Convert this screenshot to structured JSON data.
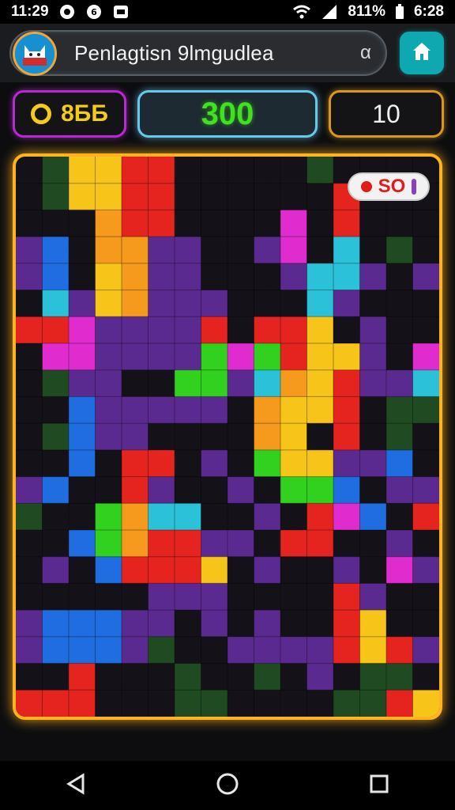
{
  "status_bar": {
    "time": "11:29",
    "battery_text": "811%",
    "clock_right": "6:28",
    "icons": [
      "settings-icon",
      "notification-icon",
      "message-icon",
      "wifi-icon",
      "signal-icon",
      "battery-icon"
    ]
  },
  "header": {
    "title": "Penlagtisn 9lmgudlea",
    "title_icon": "α",
    "logo": "app-logo",
    "home_icon": "home-icon"
  },
  "stats": {
    "coins": "8ББ",
    "score": "300",
    "level": "10"
  },
  "board": {
    "badge_value": "SO",
    "colors": {
      "black": "#151118",
      "dark_green": "#1f4a22",
      "purple": "#5b2a90",
      "magenta": "#e02ccf",
      "orange": "#f59a1c",
      "red": "#e5241f",
      "green": "#33d11f",
      "cyan": "#2bc2d9",
      "blue": "#1f6de0",
      "yellow": "#f7c419"
    }
  },
  "colors": {
    "board_border": "#ffb41f",
    "coins_border": "#b52bd0",
    "score_border": "#67c8ea",
    "level_border": "#d79820",
    "score_text": "#3fe21e",
    "coin_text": "#f4cb18",
    "home_button": "#10a8b0"
  },
  "nav": {
    "icons": [
      "back-icon",
      "home-nav-icon",
      "recents-icon"
    ]
  }
}
